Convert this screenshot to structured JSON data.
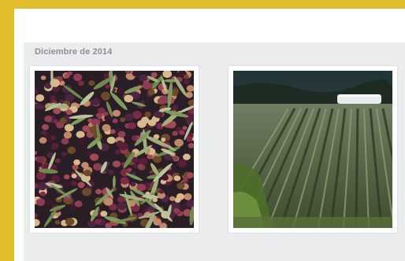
{
  "section": {
    "title": "Diciembre de 2014"
  },
  "photos": [
    {
      "subject": "olives-and-leaves"
    },
    {
      "subject": "vegetable-garden-rows"
    }
  ],
  "colors": {
    "background_border": "#e0bd2a",
    "panel": "#ebecee",
    "section_title": "#8c8f94"
  }
}
